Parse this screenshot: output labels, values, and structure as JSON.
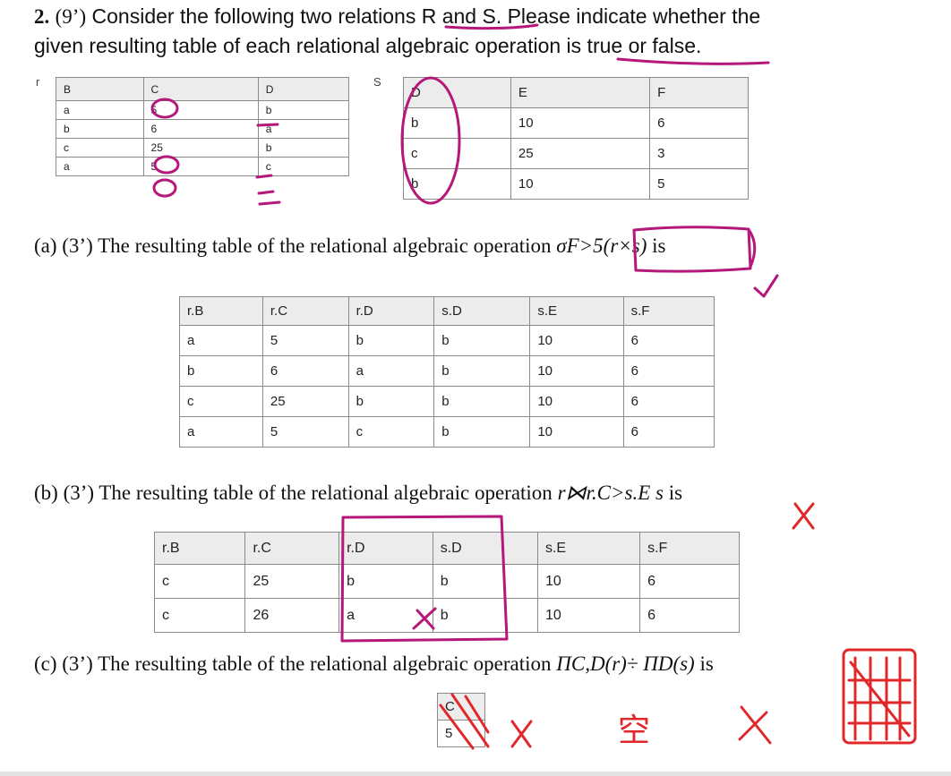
{
  "question": {
    "number": "2.",
    "points": "(9’)",
    "text_line1": "Consider the following two relations R and S. Please indicate whether the",
    "text_line2": "given resulting table of each relational algebraic operation is true or false."
  },
  "relation_r": {
    "label": "r",
    "headers": [
      "B",
      "C",
      "D"
    ],
    "rows": [
      [
        "a",
        "5",
        "b"
      ],
      [
        "b",
        "6",
        "a"
      ],
      [
        "c",
        "25",
        "b"
      ],
      [
        "a",
        "5",
        "c"
      ]
    ]
  },
  "relation_s": {
    "label": "S",
    "headers": [
      "D",
      "E",
      "F"
    ],
    "rows": [
      [
        "b",
        "10",
        "6"
      ],
      [
        "c",
        "25",
        "3"
      ],
      [
        "b",
        "10",
        "5"
      ]
    ]
  },
  "part_a": {
    "prefix": "(a) (3’) The resulting table of the relational algebraic operation",
    "operation": "σF>5(r×s)",
    "suffix": "is",
    "headers": [
      "r.B",
      "r.C",
      "r.D",
      "s.D",
      "s.E",
      "s.F"
    ],
    "rows": [
      [
        "a",
        "5",
        "b",
        "b",
        "10",
        "6"
      ],
      [
        "b",
        "6",
        "a",
        "b",
        "10",
        "6"
      ],
      [
        "c",
        "25",
        "b",
        "b",
        "10",
        "6"
      ],
      [
        "a",
        "5",
        "c",
        "b",
        "10",
        "6"
      ]
    ]
  },
  "part_b": {
    "prefix": "(b) (3’) The resulting table of the relational algebraic operation",
    "operation": "r⋈r.C>s.E s",
    "suffix": "is",
    "headers": [
      "r.B",
      "r.C",
      "r.D",
      "s.D",
      "s.E",
      "s.F"
    ],
    "rows": [
      [
        "c",
        "25",
        "b",
        "b",
        "10",
        "6"
      ],
      [
        "c",
        "26",
        "a",
        "b",
        "10",
        "6"
      ]
    ]
  },
  "part_c": {
    "prefix": "(c) (3’) The resulting table of the relational algebraic operation",
    "operation": "ΠC,D(r)÷ ΠD(s)",
    "suffix": "is",
    "headers": [
      "C"
    ],
    "rows": [
      [
        "5"
      ]
    ]
  },
  "annotations": {
    "handwritten_char": "空",
    "ink_colors": {
      "magenta": "#b5177a",
      "red": "#e0282a"
    }
  }
}
